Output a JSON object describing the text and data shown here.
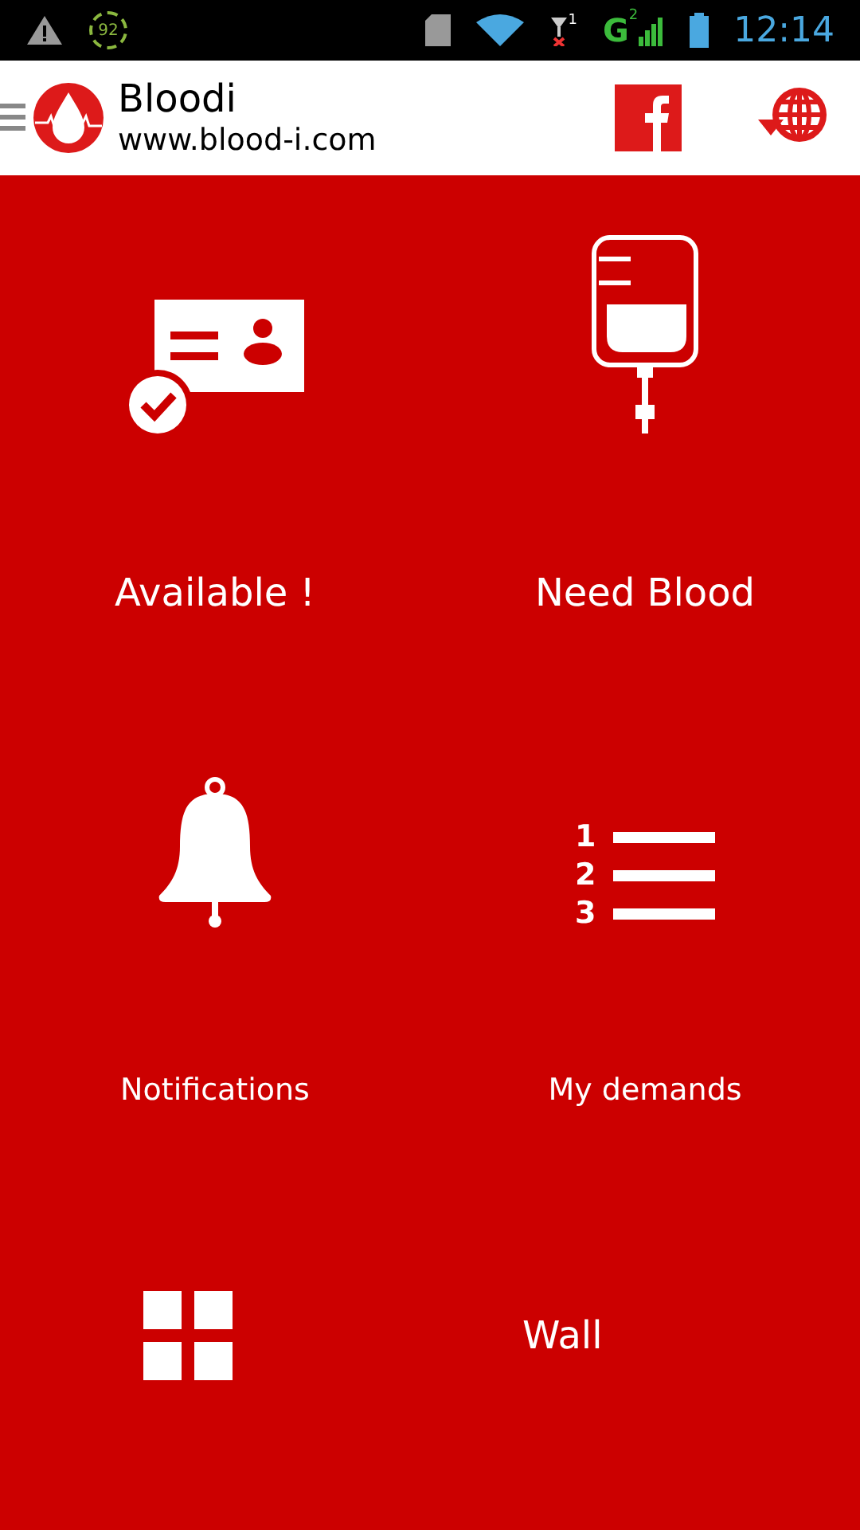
{
  "status_bar": {
    "battery_badge": "92",
    "network": "G",
    "sim_1": "1",
    "sim_2": "2",
    "time": "12:14"
  },
  "header": {
    "title": "Bloodi",
    "subtitle": "www.blood-i.com"
  },
  "tiles": [
    {
      "kind": "id-card",
      "label": "Available !"
    },
    {
      "kind": "blood-bag",
      "label": "Need Blood"
    },
    {
      "kind": "bell",
      "label": "Notifications"
    },
    {
      "kind": "numbered-list",
      "label": "My demands"
    }
  ],
  "list_icon_numbers": [
    "1",
    "2",
    "3"
  ],
  "wall_tile": {
    "kind": "grid",
    "label": "Wall"
  }
}
